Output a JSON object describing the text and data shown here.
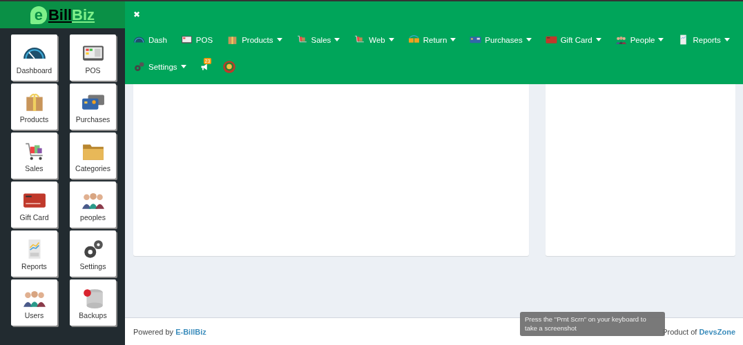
{
  "brand": {
    "prefix": "e",
    "name_dark": "Bill",
    "name_light": "Biz"
  },
  "close_label": "✖",
  "nav": [
    {
      "label": "Dash",
      "dropdown": false
    },
    {
      "label": "POS",
      "dropdown": false
    },
    {
      "label": "Products",
      "dropdown": true
    },
    {
      "label": "Sales",
      "dropdown": true
    },
    {
      "label": "Web",
      "dropdown": true
    },
    {
      "label": "Return",
      "dropdown": true
    },
    {
      "label": "Purchases",
      "dropdown": true
    },
    {
      "label": "Gift Card",
      "dropdown": true
    },
    {
      "label": "People",
      "dropdown": true
    },
    {
      "label": "Reports",
      "dropdown": true
    },
    {
      "label": "Settings",
      "dropdown": true
    }
  ],
  "notification_count": "23",
  "tiles": [
    {
      "label": "Dashboard"
    },
    {
      "label": "POS"
    },
    {
      "label": "Products"
    },
    {
      "label": "Purchases"
    },
    {
      "label": "Sales"
    },
    {
      "label": "Categories"
    },
    {
      "label": "Gift Card"
    },
    {
      "label": "peoples"
    },
    {
      "label": "Reports"
    },
    {
      "label": "Settings"
    },
    {
      "label": "Users"
    },
    {
      "label": "Backups"
    }
  ],
  "footer": {
    "powered_by": "Powered by",
    "brand_link": "E-BillBiz",
    "product_of": "Product of",
    "company_link": "DevsZone"
  },
  "tooltip": "Press the \"Prnt Scrn\" on your keyboard to take a screenshot"
}
